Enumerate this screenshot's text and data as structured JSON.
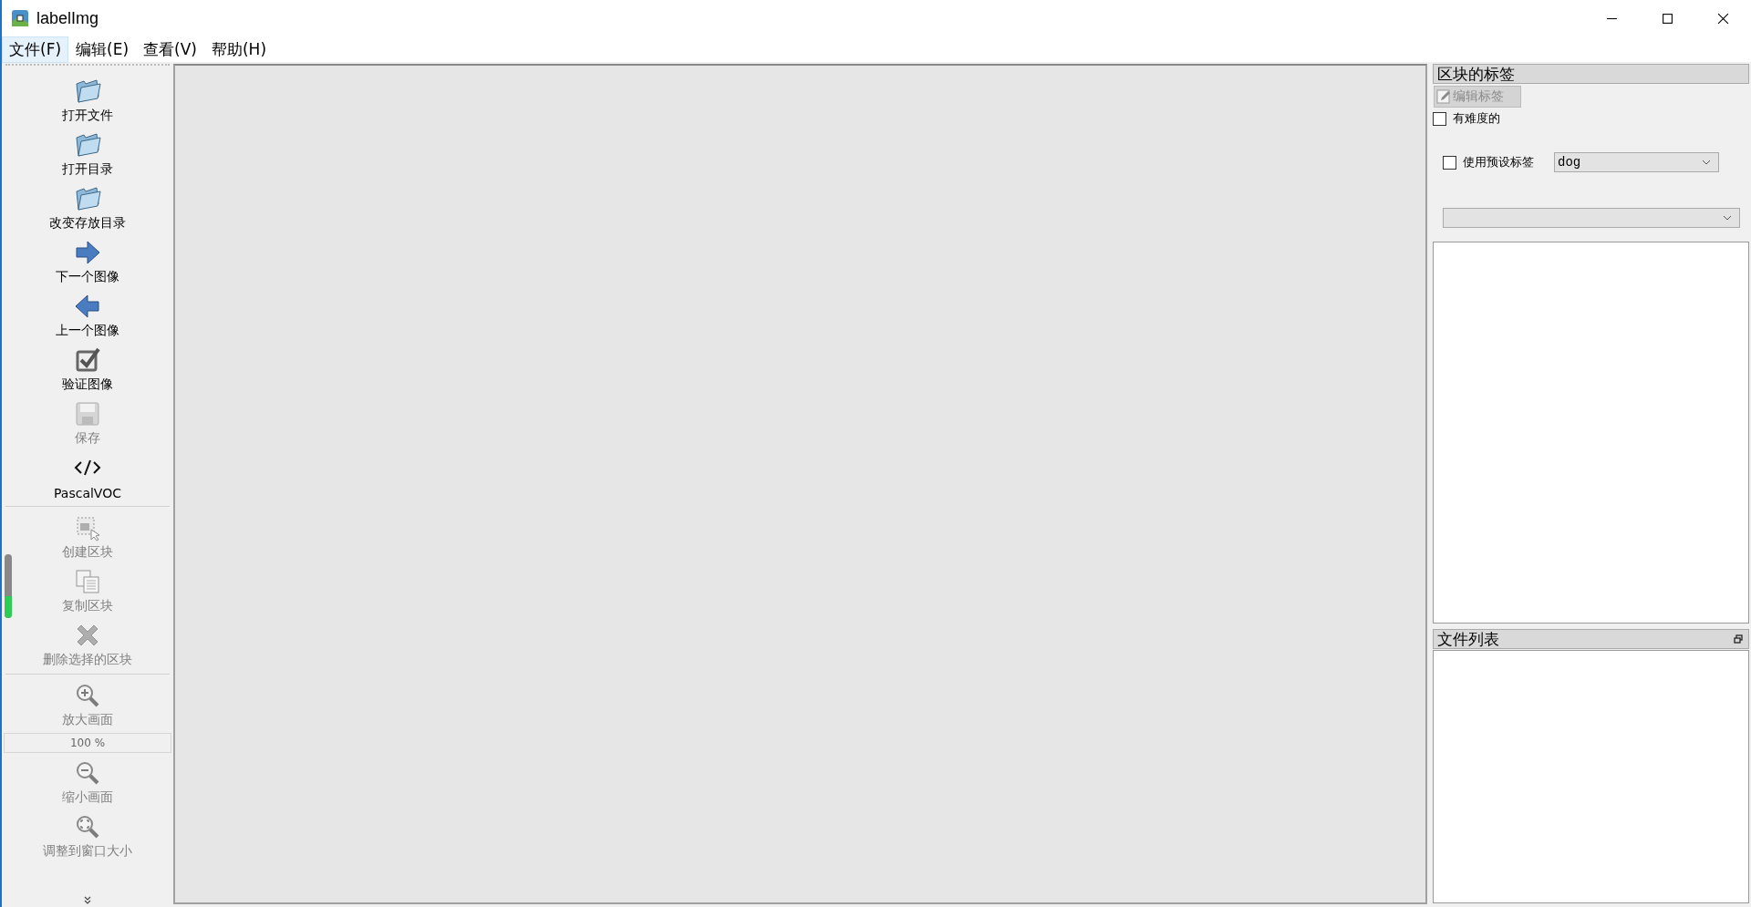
{
  "window": {
    "title": "labelImg"
  },
  "menu": [
    {
      "label": "文件(F)",
      "selected": true
    },
    {
      "label": "编辑(E)",
      "selected": false
    },
    {
      "label": "查看(V)",
      "selected": false
    },
    {
      "label": "帮助(H)",
      "selected": false
    }
  ],
  "toolbar": [
    {
      "kind": "folder",
      "label": "打开文件",
      "disabled": false
    },
    {
      "kind": "folder",
      "label": "打开目录",
      "disabled": false
    },
    {
      "kind": "folder",
      "label": "改变存放目录",
      "disabled": false
    },
    {
      "kind": "next",
      "label": "下一个图像",
      "disabled": false
    },
    {
      "kind": "prev",
      "label": "上一个图像",
      "disabled": false
    },
    {
      "kind": "verify",
      "label": "验证图像",
      "disabled": false
    },
    {
      "kind": "save",
      "label": "保存",
      "disabled": true
    },
    {
      "kind": "format",
      "label": "PascalVOC",
      "disabled": false
    },
    {
      "kind": "separator"
    },
    {
      "kind": "create",
      "label": "创建区块",
      "disabled": true
    },
    {
      "kind": "copy",
      "label": "复制区块",
      "disabled": true
    },
    {
      "kind": "delete",
      "label": "删除选择的区块",
      "disabled": true
    },
    {
      "kind": "separator"
    },
    {
      "kind": "zoomin",
      "label": "放大画面",
      "disabled": true
    },
    {
      "kind": "zoom",
      "value": "100 %"
    },
    {
      "kind": "zoomout",
      "label": "缩小画面",
      "disabled": true
    },
    {
      "kind": "fit",
      "label": "调整到窗口大小",
      "disabled": true
    },
    {
      "kind": "more"
    }
  ],
  "side_meter": {
    "level": 0.35
  },
  "label_dock": {
    "title": "区块的标签",
    "edit_button": {
      "label": "编辑标签",
      "disabled": true
    },
    "difficult": {
      "label": "有难度的",
      "checked": false
    },
    "use_default": {
      "label": "使用预设标签",
      "checked": false
    },
    "default_label": {
      "value": "dog"
    }
  },
  "file_dock": {
    "title": "文件列表"
  }
}
